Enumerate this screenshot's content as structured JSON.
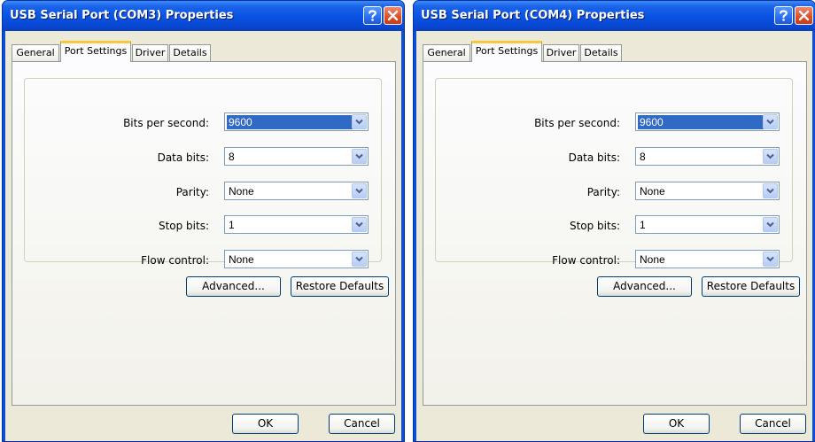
{
  "dialogs": [
    {
      "title": "USB Serial Port (COM3) Properties",
      "tabs": [
        "General",
        "Port Settings",
        "Driver",
        "Details"
      ],
      "active_tab": "Port Settings",
      "fields": [
        {
          "label": "Bits per second:",
          "value": "9600"
        },
        {
          "label": "Data bits:",
          "value": "8"
        },
        {
          "label": "Parity:",
          "value": "None"
        },
        {
          "label": "Stop bits:",
          "value": "1"
        },
        {
          "label": "Flow control:",
          "value": "None"
        }
      ],
      "buttons": {
        "advanced": "Advanced...",
        "restore": "Restore Defaults",
        "ok": "OK",
        "cancel": "Cancel"
      }
    },
    {
      "title": "USB Serial Port (COM4) Properties",
      "tabs": [
        "General",
        "Port Settings",
        "Driver",
        "Details"
      ],
      "active_tab": "Port Settings",
      "fields": [
        {
          "label": "Bits per second:",
          "value": "9600"
        },
        {
          "label": "Data bits:",
          "value": "8"
        },
        {
          "label": "Parity:",
          "value": "None"
        },
        {
          "label": "Stop bits:",
          "value": "1"
        },
        {
          "label": "Flow control:",
          "value": "None"
        }
      ],
      "buttons": {
        "advanced": "Advanced...",
        "restore": "Restore Defaults",
        "ok": "OK",
        "cancel": "Cancel"
      }
    }
  ],
  "icons": {
    "help": "help-icon",
    "close": "close-icon",
    "dropdown": "chevron-down-icon"
  },
  "colors": {
    "title_bar": "#0a54e3",
    "dialog_face": "#ece9d8",
    "selection": "#316ac5",
    "close_button": "#e0502b",
    "active_tab_accent": "#ffc83c"
  }
}
